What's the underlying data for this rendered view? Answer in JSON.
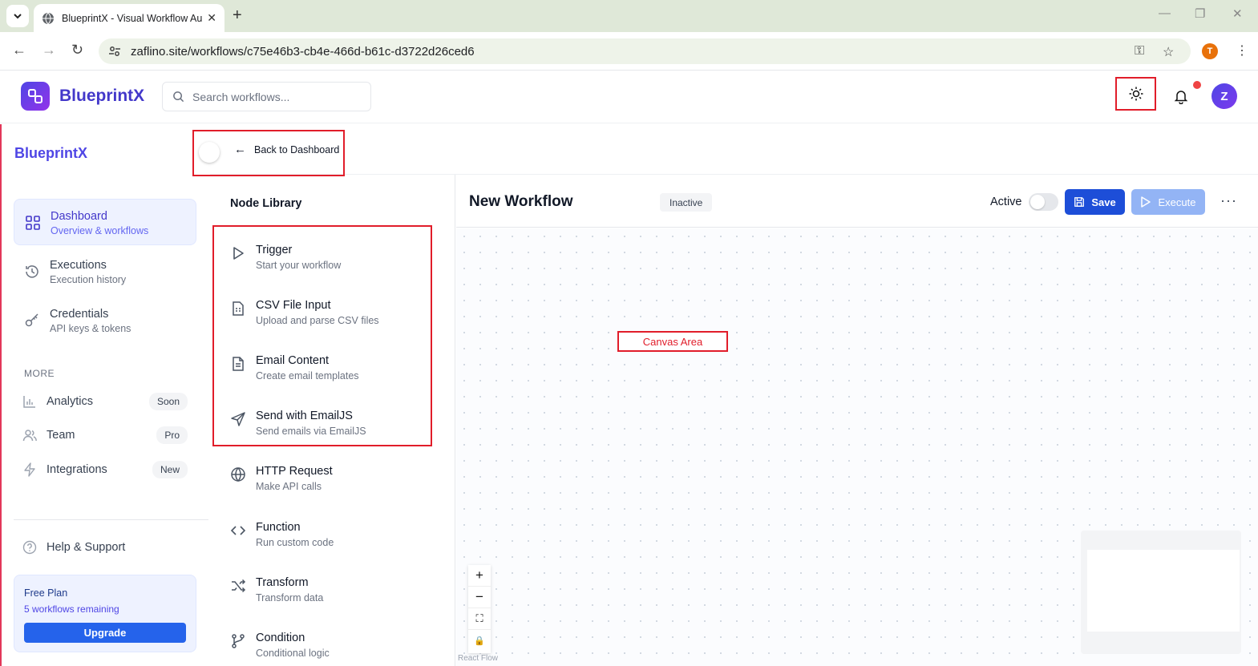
{
  "browser": {
    "tab_title": "BlueprintX - Visual Workflow Au",
    "url": "zaflino.site/workflows/c75e46b3-cb4e-466d-b61c-d3722d26ced6",
    "profile_initial": "T"
  },
  "header": {
    "brand": "BlueprintX",
    "search_placeholder": "Search workflows...",
    "avatar_initial": "Z",
    "notification_dot_color": "#ef4444"
  },
  "sidebar": {
    "brand": "BlueprintX",
    "items": [
      {
        "label": "Dashboard",
        "sub": "Overview & workflows",
        "icon": "grid-icon",
        "active": true
      },
      {
        "label": "Executions",
        "sub": "Execution history",
        "icon": "history-icon"
      },
      {
        "label": "Credentials",
        "sub": "API keys & tokens",
        "icon": "key-icon"
      }
    ],
    "more_heading": "MORE",
    "more_items": [
      {
        "label": "Analytics",
        "badge": "Soon",
        "icon": "chart-icon"
      },
      {
        "label": "Team",
        "badge": "Pro",
        "icon": "team-icon"
      },
      {
        "label": "Integrations",
        "badge": "New",
        "icon": "bolt-icon"
      }
    ],
    "help": "Help & Support",
    "plan": {
      "title": "Free Plan",
      "remaining": "5 workflows remaining",
      "upgrade": "Upgrade"
    }
  },
  "top": {
    "back_label": "Back to Dashboard"
  },
  "library": {
    "title": "Node Library",
    "nodes": [
      {
        "name": "Trigger",
        "desc": "Start your workflow",
        "icon": "play-icon"
      },
      {
        "name": "CSV File Input",
        "desc": "Upload and parse CSV files",
        "icon": "csv-file-icon"
      },
      {
        "name": "Email Content",
        "desc": "Create email templates",
        "icon": "document-icon"
      },
      {
        "name": "Send with EmailJS",
        "desc": "Send emails via EmailJS",
        "icon": "send-icon"
      },
      {
        "name": "HTTP Request",
        "desc": "Make API calls",
        "icon": "globe-icon"
      },
      {
        "name": "Function",
        "desc": "Run custom code",
        "icon": "code-icon"
      },
      {
        "name": "Transform",
        "desc": "Transform data",
        "icon": "shuffle-icon"
      },
      {
        "name": "Condition",
        "desc": "Conditional logic",
        "icon": "branch-icon"
      }
    ]
  },
  "workflow": {
    "title": "New Workflow",
    "status": "Inactive",
    "active_label": "Active",
    "active": false,
    "save": "Save",
    "execute": "Execute",
    "more": "···"
  },
  "canvas": {
    "label": "Canvas Area",
    "attribution": "React Flow",
    "controls": [
      "+",
      "−",
      "⛶",
      "🔒"
    ]
  },
  "colors": {
    "accent": "#4f46e5",
    "primary_button": "#1d4ed8",
    "annotation": "#e11d2a"
  }
}
